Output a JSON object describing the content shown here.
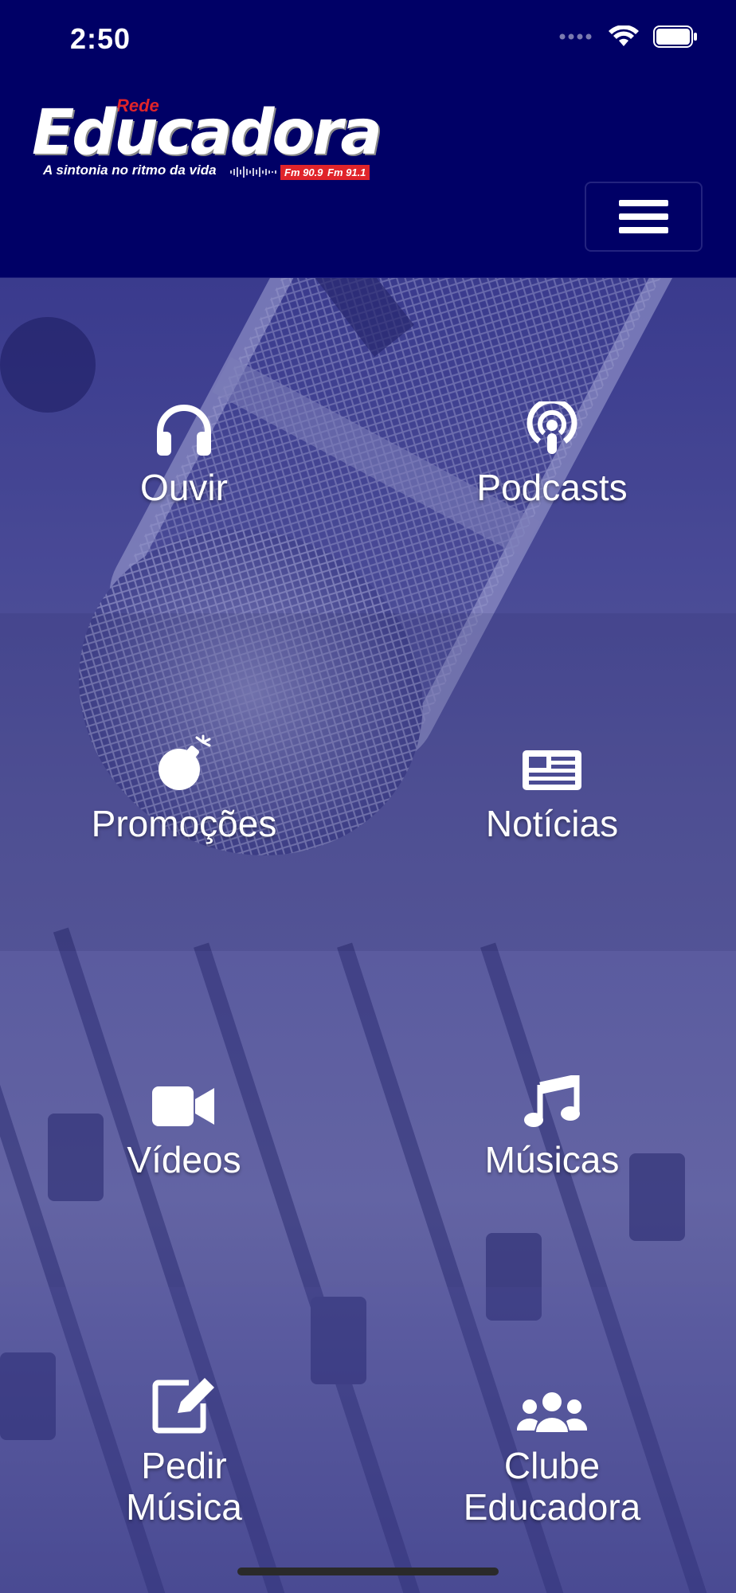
{
  "status_bar": {
    "time": "2:50"
  },
  "header": {
    "logo": {
      "rede": "Rede",
      "name": "Educadora",
      "tagline": "A sintonia no ritmo da vida",
      "freq_1": "Fm 90.9",
      "freq_2": "Fm 91.1"
    },
    "menu_icon": "hamburger-icon"
  },
  "menu": [
    {
      "label": "Ouvir",
      "icon": "headphones-icon"
    },
    {
      "label": "Podcasts",
      "icon": "podcast-icon"
    },
    {
      "label": "Promoções",
      "icon": "bomb-icon"
    },
    {
      "label": "Notícias",
      "icon": "newspaper-icon"
    },
    {
      "label": "Vídeos",
      "icon": "video-camera-icon"
    },
    {
      "label": "Músicas",
      "icon": "music-note-icon"
    },
    {
      "label_line1": "Pedir",
      "label_line2": "Música",
      "icon": "edit-icon"
    },
    {
      "label_line1": "Clube",
      "label_line2": "Educadora",
      "icon": "users-icon"
    }
  ],
  "colors": {
    "primary": "#000066",
    "accent": "#e0242a",
    "text": "#ffffff"
  }
}
